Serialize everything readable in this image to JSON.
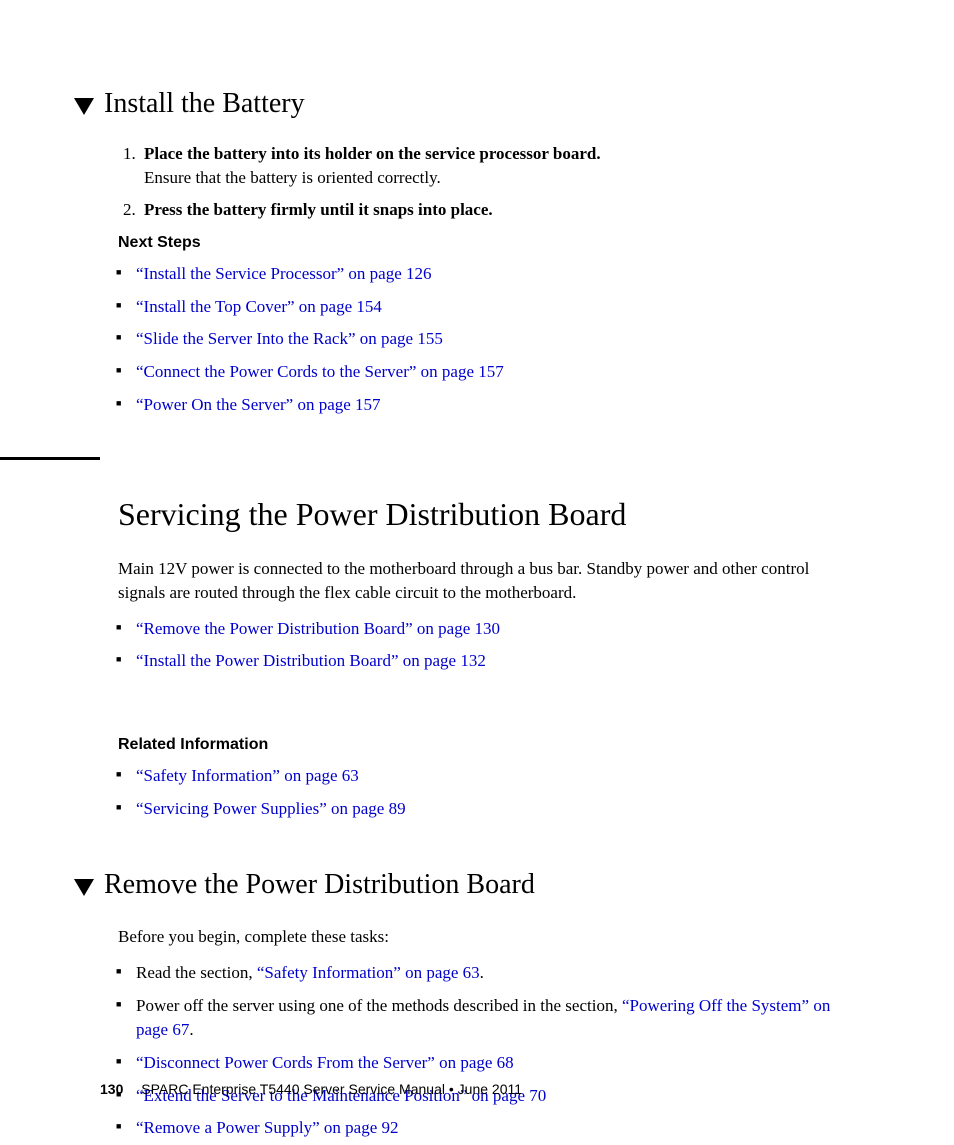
{
  "section1": {
    "title": "Install the Battery",
    "steps": [
      {
        "head": "Place the battery into its holder on the service processor board.",
        "sub": "Ensure that the battery is oriented correctly."
      },
      {
        "head": "Press the battery firmly until it snaps into place.",
        "sub": ""
      }
    ],
    "nextStepsLabel": "Next Steps",
    "nextSteps": [
      "“Install the Service Processor” on page 126",
      "“Install the Top Cover” on page 154",
      "“Slide the Server Into the Rack” on page 155",
      "“Connect the Power Cords to the Server” on page 157",
      "“Power On the Server” on page 157"
    ]
  },
  "section2": {
    "title": "Servicing the Power Distribution Board",
    "intro": "Main 12V power is connected to the motherboard through a bus bar. Standby power and other control signals are routed through the flex cable circuit to the motherboard.",
    "links": [
      "“Remove the Power Distribution Board” on page 130",
      "“Install the Power Distribution Board” on page 132"
    ],
    "relatedLabel": "Related Information",
    "related": [
      "“Safety Information” on page 63",
      "“Servicing Power Supplies” on page 89"
    ]
  },
  "section3": {
    "title": "Remove the Power Distribution Board",
    "intro": "Before you begin, complete these tasks:",
    "items": [
      {
        "pre": "Read the section, ",
        "link": "“Safety Information” on page 63",
        "post": "."
      },
      {
        "pre": "Power off the server using one of the methods described in the section, ",
        "link": "“Powering Off the System” on page 67",
        "post": "."
      },
      {
        "pre": "",
        "link": "“Disconnect Power Cords From the Server” on page 68",
        "post": ""
      },
      {
        "pre": "",
        "link": "“Extend the Server to the Maintenance Position” on page 70",
        "post": ""
      },
      {
        "pre": "",
        "link": "“Remove a Power Supply” on page 92",
        "post": ""
      }
    ]
  },
  "footer": {
    "pageNum": "130",
    "text": "SPARC Enterprise T5440 Server Service Manual  •  June 2011"
  }
}
